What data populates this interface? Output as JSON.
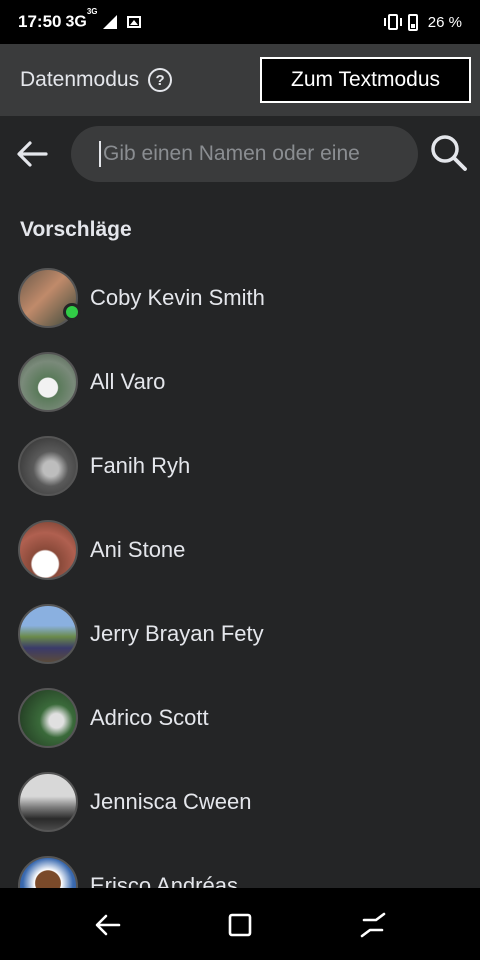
{
  "status_bar": {
    "time": "17:50",
    "network": "3G",
    "network_sup": "3G",
    "battery": "26 %"
  },
  "header": {
    "title": "Datenmodus",
    "help_icon": "?",
    "text_mode_button": "Zum Textmodus"
  },
  "search": {
    "placeholder": "Gib einen Namen oder eine"
  },
  "suggestions": {
    "title": "Vorschläge",
    "contacts": [
      {
        "name": "Coby Kevin Smith",
        "online": true
      },
      {
        "name": "All Varo",
        "online": false
      },
      {
        "name": "Fanih Ryh",
        "online": false
      },
      {
        "name": "Ani Stone",
        "online": false
      },
      {
        "name": "Jerry Brayan Fety",
        "online": false
      },
      {
        "name": "Adrico Scott",
        "online": false
      },
      {
        "name": "Jennisca Cween",
        "online": false
      },
      {
        "name": "Erisco Andréas",
        "online": false
      }
    ]
  },
  "icons": {
    "back": "arrow-left-icon",
    "search": "search-icon",
    "help": "question-circle-icon",
    "nav_back": "nav-back-icon",
    "nav_home": "nav-home-icon",
    "nav_recent": "nav-recent-icon"
  },
  "colors": {
    "background": "#242526",
    "header": "#3a3b3c",
    "online": "#31cc46"
  }
}
